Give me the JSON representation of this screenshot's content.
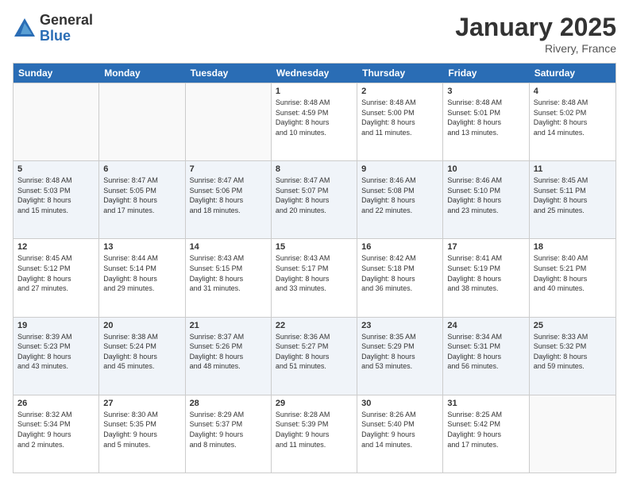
{
  "logo": {
    "general": "General",
    "blue": "Blue"
  },
  "title": "January 2025",
  "location": "Rivery, France",
  "days": [
    "Sunday",
    "Monday",
    "Tuesday",
    "Wednesday",
    "Thursday",
    "Friday",
    "Saturday"
  ],
  "weeks": [
    [
      {
        "day": "",
        "info": ""
      },
      {
        "day": "",
        "info": ""
      },
      {
        "day": "",
        "info": ""
      },
      {
        "day": "1",
        "info": "Sunrise: 8:48 AM\nSunset: 4:59 PM\nDaylight: 8 hours\nand 10 minutes."
      },
      {
        "day": "2",
        "info": "Sunrise: 8:48 AM\nSunset: 5:00 PM\nDaylight: 8 hours\nand 11 minutes."
      },
      {
        "day": "3",
        "info": "Sunrise: 8:48 AM\nSunset: 5:01 PM\nDaylight: 8 hours\nand 13 minutes."
      },
      {
        "day": "4",
        "info": "Sunrise: 8:48 AM\nSunset: 5:02 PM\nDaylight: 8 hours\nand 14 minutes."
      }
    ],
    [
      {
        "day": "5",
        "info": "Sunrise: 8:48 AM\nSunset: 5:03 PM\nDaylight: 8 hours\nand 15 minutes."
      },
      {
        "day": "6",
        "info": "Sunrise: 8:47 AM\nSunset: 5:05 PM\nDaylight: 8 hours\nand 17 minutes."
      },
      {
        "day": "7",
        "info": "Sunrise: 8:47 AM\nSunset: 5:06 PM\nDaylight: 8 hours\nand 18 minutes."
      },
      {
        "day": "8",
        "info": "Sunrise: 8:47 AM\nSunset: 5:07 PM\nDaylight: 8 hours\nand 20 minutes."
      },
      {
        "day": "9",
        "info": "Sunrise: 8:46 AM\nSunset: 5:08 PM\nDaylight: 8 hours\nand 22 minutes."
      },
      {
        "day": "10",
        "info": "Sunrise: 8:46 AM\nSunset: 5:10 PM\nDaylight: 8 hours\nand 23 minutes."
      },
      {
        "day": "11",
        "info": "Sunrise: 8:45 AM\nSunset: 5:11 PM\nDaylight: 8 hours\nand 25 minutes."
      }
    ],
    [
      {
        "day": "12",
        "info": "Sunrise: 8:45 AM\nSunset: 5:12 PM\nDaylight: 8 hours\nand 27 minutes."
      },
      {
        "day": "13",
        "info": "Sunrise: 8:44 AM\nSunset: 5:14 PM\nDaylight: 8 hours\nand 29 minutes."
      },
      {
        "day": "14",
        "info": "Sunrise: 8:43 AM\nSunset: 5:15 PM\nDaylight: 8 hours\nand 31 minutes."
      },
      {
        "day": "15",
        "info": "Sunrise: 8:43 AM\nSunset: 5:17 PM\nDaylight: 8 hours\nand 33 minutes."
      },
      {
        "day": "16",
        "info": "Sunrise: 8:42 AM\nSunset: 5:18 PM\nDaylight: 8 hours\nand 36 minutes."
      },
      {
        "day": "17",
        "info": "Sunrise: 8:41 AM\nSunset: 5:19 PM\nDaylight: 8 hours\nand 38 minutes."
      },
      {
        "day": "18",
        "info": "Sunrise: 8:40 AM\nSunset: 5:21 PM\nDaylight: 8 hours\nand 40 minutes."
      }
    ],
    [
      {
        "day": "19",
        "info": "Sunrise: 8:39 AM\nSunset: 5:23 PM\nDaylight: 8 hours\nand 43 minutes."
      },
      {
        "day": "20",
        "info": "Sunrise: 8:38 AM\nSunset: 5:24 PM\nDaylight: 8 hours\nand 45 minutes."
      },
      {
        "day": "21",
        "info": "Sunrise: 8:37 AM\nSunset: 5:26 PM\nDaylight: 8 hours\nand 48 minutes."
      },
      {
        "day": "22",
        "info": "Sunrise: 8:36 AM\nSunset: 5:27 PM\nDaylight: 8 hours\nand 51 minutes."
      },
      {
        "day": "23",
        "info": "Sunrise: 8:35 AM\nSunset: 5:29 PM\nDaylight: 8 hours\nand 53 minutes."
      },
      {
        "day": "24",
        "info": "Sunrise: 8:34 AM\nSunset: 5:31 PM\nDaylight: 8 hours\nand 56 minutes."
      },
      {
        "day": "25",
        "info": "Sunrise: 8:33 AM\nSunset: 5:32 PM\nDaylight: 8 hours\nand 59 minutes."
      }
    ],
    [
      {
        "day": "26",
        "info": "Sunrise: 8:32 AM\nSunset: 5:34 PM\nDaylight: 9 hours\nand 2 minutes."
      },
      {
        "day": "27",
        "info": "Sunrise: 8:30 AM\nSunset: 5:35 PM\nDaylight: 9 hours\nand 5 minutes."
      },
      {
        "day": "28",
        "info": "Sunrise: 8:29 AM\nSunset: 5:37 PM\nDaylight: 9 hours\nand 8 minutes."
      },
      {
        "day": "29",
        "info": "Sunrise: 8:28 AM\nSunset: 5:39 PM\nDaylight: 9 hours\nand 11 minutes."
      },
      {
        "day": "30",
        "info": "Sunrise: 8:26 AM\nSunset: 5:40 PM\nDaylight: 9 hours\nand 14 minutes."
      },
      {
        "day": "31",
        "info": "Sunrise: 8:25 AM\nSunset: 5:42 PM\nDaylight: 9 hours\nand 17 minutes."
      },
      {
        "day": "",
        "info": ""
      }
    ]
  ],
  "alt_rows": [
    1,
    3
  ]
}
